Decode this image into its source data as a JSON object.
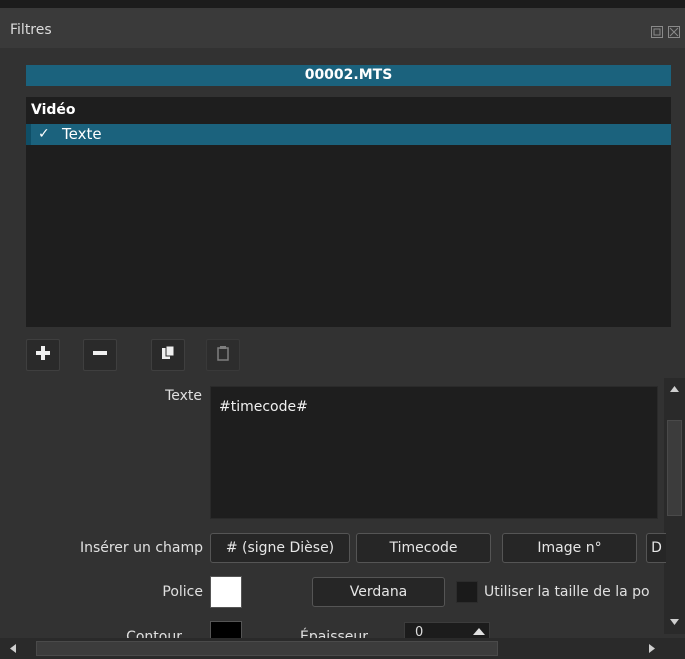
{
  "panel": {
    "title": "Filtres"
  },
  "clip": {
    "name": "00002.MTS"
  },
  "filter_list": {
    "heading": "Vidéo",
    "items": [
      {
        "check": "✓",
        "label": "Texte"
      }
    ]
  },
  "toolbar": {
    "icons": [
      "plus-icon",
      "minus-icon",
      "copy-icon",
      "paste-icon"
    ]
  },
  "form": {
    "text_label": "Texte",
    "text_value": "#timecode#",
    "insert_label": "Insérer un champ",
    "insert_buttons": [
      "# (signe Dièse)",
      "Timecode",
      "Image n°",
      "D"
    ],
    "font_label": "Police",
    "font_button": "Verdana",
    "font_size_checkbox_label": "Utiliser la taille de la po",
    "outline_label": "Contour",
    "thickness_label": "Épaisseur",
    "thickness_value": "0"
  },
  "colors": {
    "accent": "#1b627d",
    "text_color": "#ffffff",
    "outline_color": "#000000"
  }
}
